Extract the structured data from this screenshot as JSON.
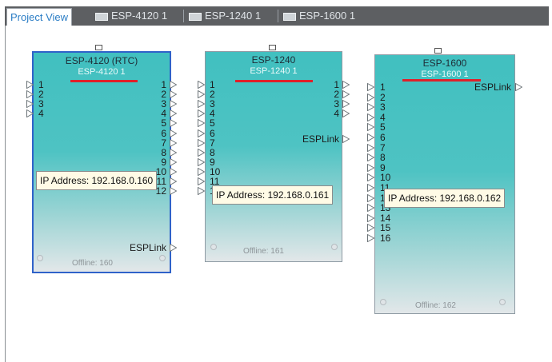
{
  "tabs": [
    {
      "label": "Project View",
      "active": true
    },
    {
      "label": "ESP-4120 1",
      "active": false
    },
    {
      "label": "ESP-1240 1",
      "active": false
    },
    {
      "label": "ESP-1600 1",
      "active": false
    }
  ],
  "devices": [
    {
      "title": "ESP-4120 (RTC)",
      "subtitle": "ESP-4120 1",
      "inputs": [
        "1",
        "2",
        "3",
        "4"
      ],
      "outputs": [
        "1",
        "2",
        "3",
        "4",
        "5",
        "6",
        "7",
        "8",
        "9",
        "10",
        "11",
        "12"
      ],
      "link_label": "ESPLink",
      "status": "Offline: 160",
      "tooltip": "IP Address: 192.168.0.160",
      "selected": true
    },
    {
      "title": "ESP-1240",
      "subtitle": "ESP-1240 1",
      "inputs": [
        "1",
        "2",
        "3",
        "4",
        "5",
        "6",
        "7",
        "8",
        "9",
        "10",
        "11",
        "12"
      ],
      "outputs": [
        "1",
        "2",
        "3",
        "4"
      ],
      "link_label": "ESPLink",
      "status": "Offline: 161",
      "tooltip": "IP Address: 192.168.0.161",
      "selected": false
    },
    {
      "title": "ESP-1600",
      "subtitle": "ESP-1600 1",
      "inputs": [
        "1",
        "2",
        "3",
        "4",
        "5",
        "6",
        "7",
        "8",
        "9",
        "10",
        "11",
        "12",
        "13",
        "14",
        "15",
        "16"
      ],
      "outputs": [],
      "link_label": "ESPLink",
      "status": "Offline: 162",
      "tooltip": "IP Address: 192.168.0.162",
      "selected": false
    }
  ],
  "colors": {
    "device_fill": "#41c0c0",
    "selection_border": "#2f62c9",
    "highlight_underline": "#e0202a",
    "active_tab_text": "#2b7dc5"
  }
}
